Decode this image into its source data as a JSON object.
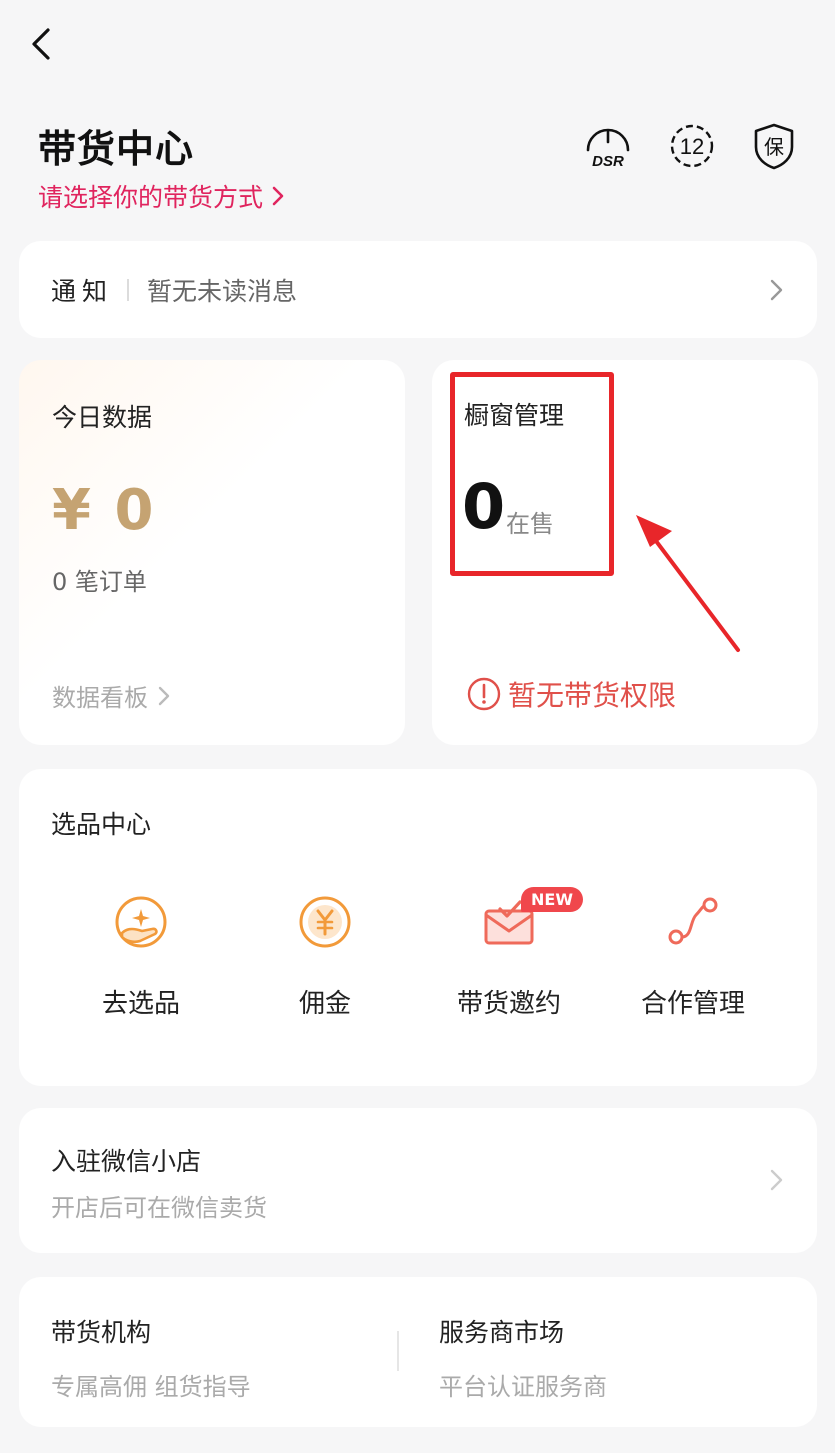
{
  "header": {
    "title": "带货中心",
    "subtitle": "请选择你的带货方式",
    "icons": [
      "dsr-icon",
      "twelve-icon",
      "shield-icon"
    ],
    "dsr_text": "DSR",
    "twelve_text": "12",
    "shield_text": "保"
  },
  "notice": {
    "label": "通知",
    "message": "暂无未读消息"
  },
  "today": {
    "title": "今日数据",
    "money": "¥ 0",
    "orders": "0 笔订单",
    "board_label": "数据看板"
  },
  "window_mgmt": {
    "title": "橱窗管理",
    "count": "0",
    "count_label": "在售",
    "permission": "暂无带货权限"
  },
  "pick_center": {
    "title": "选品中心",
    "tools": [
      {
        "label": "去选品",
        "icon": "hand-star-icon"
      },
      {
        "label": "佣金",
        "icon": "yuan-coin-icon"
      },
      {
        "label": "带货邀约",
        "icon": "envelope-check-icon"
      },
      {
        "label": "合作管理",
        "icon": "route-icon"
      }
    ],
    "new_badge": "NEW"
  },
  "wechat_shop": {
    "title": "入驻微信小店",
    "desc": "开店后可在微信卖货"
  },
  "bottom": {
    "left_title": "带货机构",
    "left_desc": "专属高佣 组货指导",
    "right_title": "服务商市场",
    "right_desc": "平台认证服务商"
  },
  "colors": {
    "accent": "#e0245e",
    "gold": "#c5a372",
    "warn": "#e0504a",
    "icon_orange": "#f29a3a",
    "highlight": "#e8262a"
  }
}
